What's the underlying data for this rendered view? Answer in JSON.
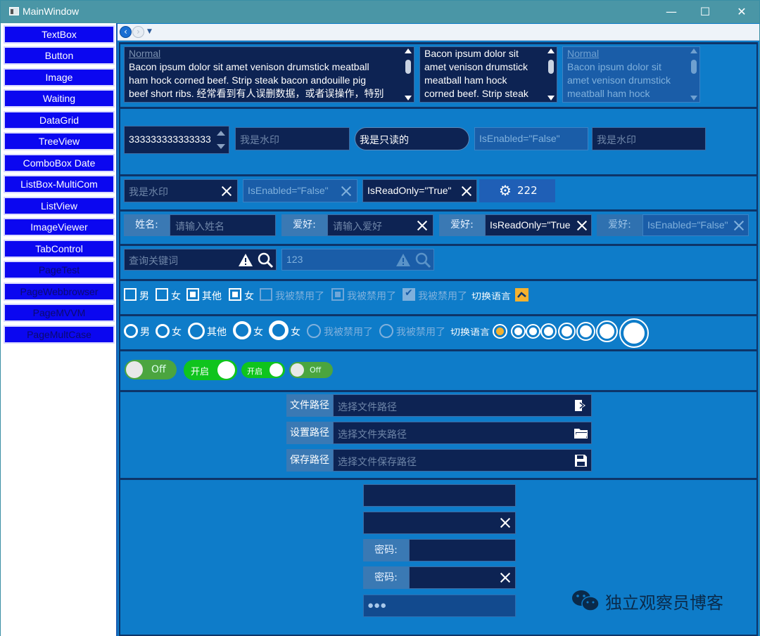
{
  "window": {
    "title": "MainWindow",
    "minimize": "—",
    "maximize": "☐",
    "close": "✕"
  },
  "nav": [
    {
      "label": "TextBox"
    },
    {
      "label": "Button"
    },
    {
      "label": "Image"
    },
    {
      "label": "Waiting"
    },
    {
      "label": "DataGrid"
    },
    {
      "label": "TreeView"
    },
    {
      "label": "ComboBox Date"
    },
    {
      "label": "ListBox-MultiCom"
    },
    {
      "label": "ListView"
    },
    {
      "label": "ImageViewer"
    },
    {
      "label": "TabControl"
    },
    {
      "label": "PageTest"
    },
    {
      "label": "PageWebbrowser"
    },
    {
      "label": "PageMVVM"
    },
    {
      "label": "PageMultCase"
    }
  ],
  "multiline": {
    "box1": {
      "header": "Normal",
      "lines": [
        "Bacon ipsum dolor sit amet venison drumstick meatball",
        "ham hock corned beef. Strip steak bacon andouille pig",
        "beef short ribs. 经常看到有人误删数据，或者误操作，特别"
      ]
    },
    "box2": {
      "lines": [
        "Bacon ipsum dolor sit",
        "amet venison drumstick",
        "meatball ham hock",
        "corned beef. Strip steak"
      ]
    },
    "box3": {
      "header": "Normal",
      "lines": [
        "Bacon ipsum dolor sit",
        "amet venison drumstick",
        "meatball ham hock"
      ]
    }
  },
  "row2": {
    "numeric_value": "333333333333333",
    "watermark1": "我是水印",
    "readonly_round": "我是只读的",
    "disabled_text": "IsEnabled=\"False\"",
    "watermark2": "我是水印"
  },
  "row3": {
    "watermark": "我是水印",
    "disabled_text": "IsEnabled=\"False\"",
    "readonly_text": "IsReadOnly=\"True\"",
    "gear_button_label": "222"
  },
  "row4": {
    "name_label": "姓名:",
    "name_placeholder": "请输入姓名",
    "hobby_label": "爱好:",
    "hobby_placeholder": "请输入爱好",
    "hobby2_label": "爱好:",
    "hobby2_value": "IsReadOnly=\"True",
    "hobby3_label": "爱好:",
    "hobby3_value": "IsEnabled=\"False\""
  },
  "row5": {
    "search_placeholder": "查询关键词",
    "search2_value": "123"
  },
  "checkboxes": [
    {
      "label": "男"
    },
    {
      "label": "女"
    },
    {
      "label": "其他"
    },
    {
      "label": "女"
    },
    {
      "label": "我被禁用了"
    },
    {
      "label": "我被禁用了"
    },
    {
      "label": "我被禁用了"
    }
  ],
  "checkbox_text_toggle": "切换语言",
  "radios": [
    {
      "label": "男"
    },
    {
      "label": "女"
    },
    {
      "label": "其他"
    },
    {
      "label": "女"
    },
    {
      "label": "女"
    },
    {
      "label": "我被禁用了"
    },
    {
      "label": "我被禁用了"
    }
  ],
  "radio_text_toggle": "切换语言",
  "toggles": [
    {
      "label": "Off",
      "on": false
    },
    {
      "label": "开启",
      "on": true
    },
    {
      "label": "开启",
      "on": true
    },
    {
      "label": "Off",
      "on": false
    }
  ],
  "paths": [
    {
      "label": "文件路径",
      "placeholder": "选择文件路径",
      "icon": "open-file-icon"
    },
    {
      "label": "设置路径",
      "placeholder": "选择文件夹路径",
      "icon": "folder-icon"
    },
    {
      "label": "保存路径",
      "placeholder": "选择文件保存路径",
      "icon": "save-icon"
    }
  ],
  "passwords": {
    "label1": "密码:",
    "label2": "密码:",
    "masked": "●●●"
  },
  "watermark_brand": "独立观察员博客",
  "colors": {
    "accent": "#0e7cc9",
    "dark_field": "#0d2353",
    "nav_button": "#0b07f0",
    "toggle_green": "#0fc41d",
    "warning_orange": "#f5b12e"
  }
}
